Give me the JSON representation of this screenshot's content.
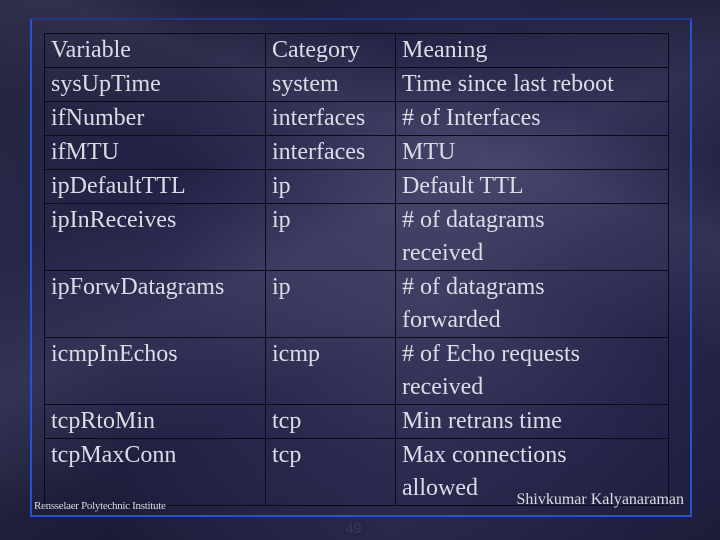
{
  "table": {
    "headers": [
      "Variable",
      "Category",
      "Meaning"
    ],
    "rows": [
      {
        "variable": "sysUpTime",
        "category": "system",
        "meaning": [
          "Time since last reboot"
        ]
      },
      {
        "variable": "ifNumber",
        "category": "interfaces",
        "meaning": [
          "# of Interfaces"
        ]
      },
      {
        "variable": "ifMTU",
        "category": "interfaces",
        "meaning": [
          "MTU"
        ]
      },
      {
        "variable": "ipDefaultTTL",
        "category": "ip",
        "meaning": [
          "Default TTL"
        ]
      },
      {
        "variable": "ipInReceives",
        "category": "ip",
        "meaning": [
          "# of datagrams",
          "received"
        ]
      },
      {
        "variable": "ipForwDatagrams",
        "category": "ip",
        "meaning": [
          "# of datagrams",
          "forwarded"
        ]
      },
      {
        "variable": "icmpInEchos",
        "category": "icmp",
        "meaning": [
          "# of Echo requests",
          "received"
        ]
      },
      {
        "variable": "tcpRtoMin",
        "category": "tcp",
        "meaning": [
          "Min retrans time"
        ]
      },
      {
        "variable": "tcpMaxConn",
        "category": "tcp",
        "meaning": [
          "Max connections",
          "allowed"
        ]
      }
    ]
  },
  "footer": {
    "institution": "Rensselaer Polytechnic Institute",
    "author": "Shivkumar Kalyanaraman",
    "page": "49"
  },
  "colors": {
    "frame": "#2a4fd0",
    "text": "#dcdce6",
    "background": "#1e1e40"
  }
}
